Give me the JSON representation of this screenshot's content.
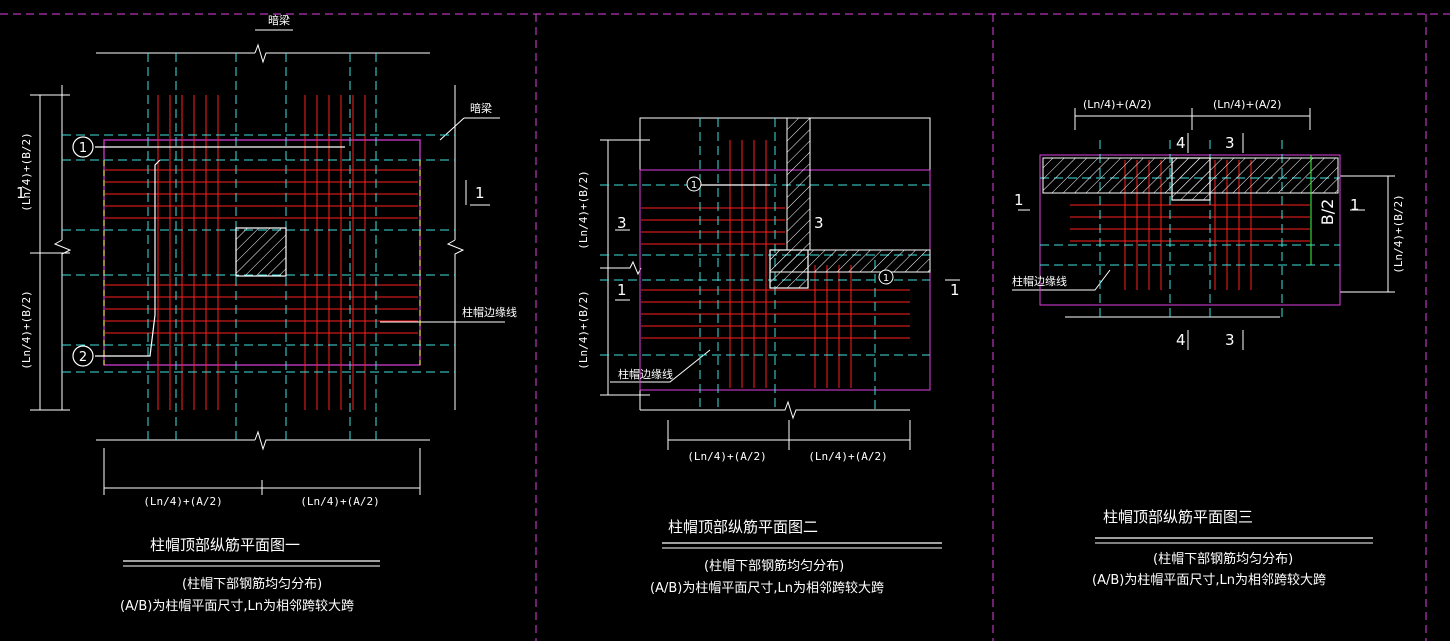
{
  "colors": {
    "background": "#000000",
    "rebar_red": "#ff2020",
    "axis_cyan": "#40e0e0",
    "outline_magenta": "#e040e0",
    "border_white": "#ffffff",
    "hatch_white": "#ffffff",
    "green_mark": "#40ff40",
    "edge_yellow": "#ffff40"
  },
  "panel1": {
    "beam_top": "暗梁",
    "beam_right": "暗梁",
    "dim_left_upper": "(Ln/4)+(B/2)",
    "dim_left_lower": "(Ln/4)+(B/2)",
    "dim_bottom_left": "(Ln/4)+(A/2)",
    "dim_bottom_right": "(Ln/4)+(A/2)",
    "mark_1": "1",
    "mark_2": "2",
    "sec_left": "1",
    "sec_right": "1",
    "edge_label": "柱帽边缘线",
    "title": "柱帽顶部纵筋平面图一",
    "note1": "(柱帽下部钢筋均匀分布)",
    "note2": "(A/B)为柱帽平面尺寸,Ln为相邻跨较大跨"
  },
  "panel2": {
    "dim_left_upper": "(Ln/4)+(B/2)",
    "dim_left_lower": "(Ln/4)+(B/2)",
    "dim_bottom_left": "(Ln/4)+(A/2)",
    "dim_bottom_right": "(Ln/4)+(A/2)",
    "sec_3_left": "3",
    "sec_3_right": "3",
    "sec_1_left": "1",
    "sec_1_right": "1",
    "mark_1a": "1",
    "mark_1b": "1",
    "edge_label": "柱帽边缘线",
    "title": "柱帽顶部纵筋平面图二",
    "note1": "(柱帽下部钢筋均匀分布)",
    "note2": "(A/B)为柱帽平面尺寸,Ln为相邻跨较大跨"
  },
  "panel3": {
    "dim_top_left": "(Ln/4)+(A/2)",
    "dim_top_right": "(Ln/4)+(A/2)",
    "dim_right": "(Ln/4)+(B/2)",
    "b_half": "B/2",
    "sec_4_top": "4",
    "sec_3_top": "3",
    "sec_4_bot": "4",
    "sec_3_bot": "3",
    "sec_1_left": "1",
    "sec_1_right": "1",
    "edge_label": "柱帽边缘线",
    "title": "柱帽顶部纵筋平面图三",
    "note1": "(柱帽下部钢筋均匀分布)",
    "note2": "(A/B)为柱帽平面尺寸,Ln为相邻跨较大跨"
  }
}
